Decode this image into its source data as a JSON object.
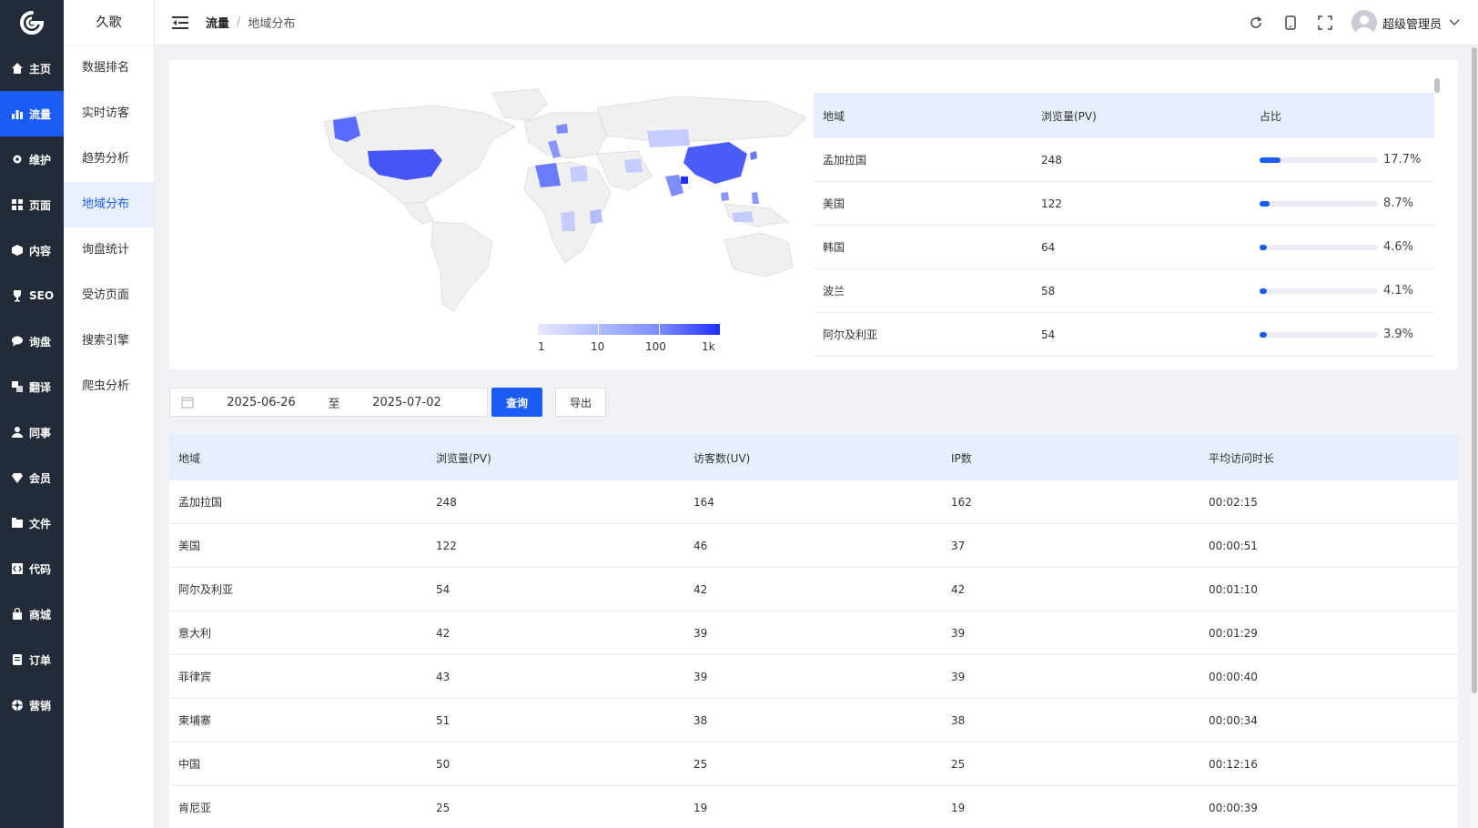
{
  "nav": {
    "items": [
      {
        "label": "主页",
        "icon": "home-icon"
      },
      {
        "label": "流量",
        "icon": "bar-chart-icon",
        "active": true
      },
      {
        "label": "维护",
        "icon": "gear-icon"
      },
      {
        "label": "页面",
        "icon": "grid-icon"
      },
      {
        "label": "内容",
        "icon": "cube-icon"
      },
      {
        "label": "SEO",
        "icon": "trophy-icon"
      },
      {
        "label": "询盘",
        "icon": "chat-icon"
      },
      {
        "label": "翻译",
        "icon": "translate-icon"
      },
      {
        "label": "同事",
        "icon": "user-icon"
      },
      {
        "label": "会员",
        "icon": "diamond-icon"
      },
      {
        "label": "文件",
        "icon": "file-icon"
      },
      {
        "label": "代码",
        "icon": "code-icon"
      },
      {
        "label": "商城",
        "icon": "shopping-bag-icon"
      },
      {
        "label": "订单",
        "icon": "order-icon"
      },
      {
        "label": "营销",
        "icon": "marketing-icon"
      }
    ]
  },
  "subnav": {
    "title": "久歌",
    "items": [
      "数据排名",
      "实时访客",
      "趋势分析",
      "地域分布",
      "询盘统计",
      "受访页面",
      "搜索引擎",
      "爬虫分析"
    ],
    "active_index": 3
  },
  "breadcrumb": {
    "parent": "流量",
    "sep": "/",
    "current": "地域分布"
  },
  "user": {
    "name": "超级管理员"
  },
  "map_legend": {
    "labels": [
      "1",
      "10",
      "100",
      "1k"
    ],
    "colors": [
      "#e6e9ff",
      "#b3bcff",
      "#7b8bff",
      "#1f2fff"
    ]
  },
  "geo_table": {
    "headers": [
      "地域",
      "浏览量(PV)",
      "占比"
    ],
    "rows": [
      {
        "region": "孟加拉国",
        "pv": "248",
        "ratio": "17.7%",
        "fraction": 0.177
      },
      {
        "region": "美国",
        "pv": "122",
        "ratio": "8.7%",
        "fraction": 0.087
      },
      {
        "region": "韩国",
        "pv": "64",
        "ratio": "4.6%",
        "fraction": 0.046
      },
      {
        "region": "波兰",
        "pv": "58",
        "ratio": "4.1%",
        "fraction": 0.041
      },
      {
        "region": "阿尔及利亚",
        "pv": "54",
        "ratio": "3.9%",
        "fraction": 0.039
      }
    ]
  },
  "filter": {
    "start_date": "2025-06-26",
    "to": "至",
    "end_date": "2025-07-02",
    "query_label": "查询",
    "export_label": "导出"
  },
  "detail_table": {
    "headers": [
      "地域",
      "浏览量(PV)",
      "访客数(UV)",
      "IP数",
      "平均访问时长"
    ],
    "rows": [
      [
        "孟加拉国",
        "248",
        "164",
        "162",
        "00:02:15"
      ],
      [
        "美国",
        "122",
        "46",
        "37",
        "00:00:51"
      ],
      [
        "阿尔及利亚",
        "54",
        "42",
        "42",
        "00:01:10"
      ],
      [
        "意大利",
        "42",
        "39",
        "39",
        "00:01:29"
      ],
      [
        "菲律宾",
        "43",
        "39",
        "39",
        "00:00:40"
      ],
      [
        "柬埔寨",
        "51",
        "38",
        "38",
        "00:00:34"
      ],
      [
        "中国",
        "50",
        "25",
        "25",
        "00:12:16"
      ],
      [
        "肯尼亚",
        "25",
        "19",
        "19",
        "00:00:39"
      ]
    ]
  },
  "colors": {
    "accent": "#1a5cf5",
    "sidebar_bg": "#222b38",
    "header_row_bg": "#e6eefc"
  }
}
